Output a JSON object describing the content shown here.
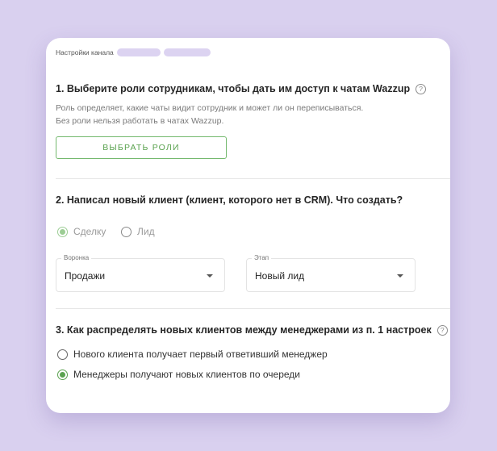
{
  "breadcrumb": {
    "label": "Настройки канала"
  },
  "section1": {
    "heading": "1. Выберите роли сотрудникам, чтобы дать им доступ к чатам Wazzup",
    "desc_line1": "Роль определяет, какие чаты видит сотрудник и может ли он переписываться.",
    "desc_line2": "Без роли нельзя работать в чатах Wazzup.",
    "button": "ВЫБРАТЬ РОЛИ"
  },
  "section2": {
    "heading": "2. Написал новый клиент (клиент, которого нет в CRM). Что создать?",
    "options": [
      "Сделку",
      "Лид"
    ],
    "selected": "Сделку",
    "funnel": {
      "legend": "Воронка",
      "value": "Продажи"
    },
    "stage": {
      "legend": "Этап",
      "value": "Новый лид"
    }
  },
  "section3": {
    "heading": "3. Как распределять новых клиентов между менеджерами из п. 1 настроек",
    "options": [
      "Нового клиента получает первый ответивший менеджер",
      "Менеджеры получают новых клиентов по очереди"
    ],
    "selected": "Менеджеры получают новых клиентов по очереди"
  },
  "icons": {
    "help": "?"
  },
  "colors": {
    "accent": "#5aa24f",
    "background": "#d9d0ef"
  }
}
